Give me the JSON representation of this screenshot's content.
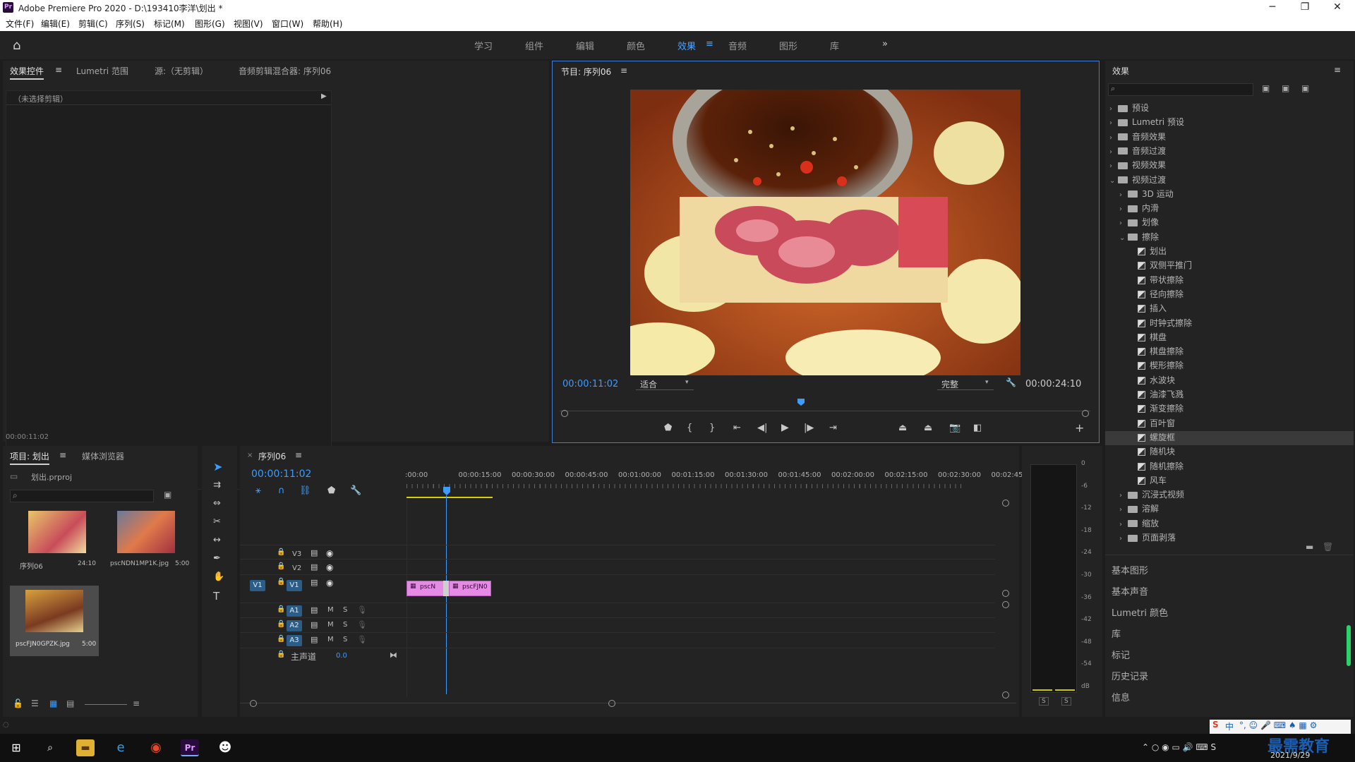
{
  "window": {
    "app_badge": "Pr",
    "title": "Adobe Premiere Pro 2020 - D:\\193410李洋\\划出 *",
    "minimize": "─",
    "maximize": "❐",
    "close": "✕"
  },
  "menu": [
    "文件(F)",
    "编辑(E)",
    "剪辑(C)",
    "序列(S)",
    "标记(M)",
    "图形(G)",
    "视图(V)",
    "窗口(W)",
    "帮助(H)"
  ],
  "workspaces": [
    "学习",
    "组件",
    "编辑",
    "颜色",
    "效果",
    "音频",
    "图形",
    "库"
  ],
  "workspace_active": "效果",
  "workspace_more": "»",
  "source_panel": {
    "tabs": [
      "效果控件",
      "Lumetri 范围",
      "源:（无剪辑）",
      "音频剪辑混合器: 序列06"
    ],
    "no_clip": "（未选择剪辑）",
    "timecode": "00:00:11:02"
  },
  "program": {
    "title": "节目: 序列06",
    "timecode": "00:00:11:02",
    "fit": "适合",
    "quality": "完整",
    "duration": "00:00:24:10"
  },
  "effects_panel": {
    "title": "效果",
    "tree": [
      {
        "label": "预设",
        "level": 0,
        "type": "folder",
        "open": false
      },
      {
        "label": "Lumetri 预设",
        "level": 0,
        "type": "folder",
        "open": false
      },
      {
        "label": "音频效果",
        "level": 0,
        "type": "folder",
        "open": false
      },
      {
        "label": "音频过渡",
        "level": 0,
        "type": "folder",
        "open": false
      },
      {
        "label": "视频效果",
        "level": 0,
        "type": "folder",
        "open": false
      },
      {
        "label": "视频过渡",
        "level": 0,
        "type": "folder",
        "open": true
      },
      {
        "label": "3D 运动",
        "level": 1,
        "type": "folder",
        "open": false
      },
      {
        "label": "内滑",
        "level": 1,
        "type": "folder",
        "open": false
      },
      {
        "label": "划像",
        "level": 1,
        "type": "folder",
        "open": false
      },
      {
        "label": "擦除",
        "level": 1,
        "type": "folder",
        "open": true
      },
      {
        "label": "划出",
        "level": 2,
        "type": "fx"
      },
      {
        "label": "双侧平推门",
        "level": 2,
        "type": "fx"
      },
      {
        "label": "带状擦除",
        "level": 2,
        "type": "fx"
      },
      {
        "label": "径向擦除",
        "level": 2,
        "type": "fx"
      },
      {
        "label": "插入",
        "level": 2,
        "type": "fx"
      },
      {
        "label": "时钟式擦除",
        "level": 2,
        "type": "fx"
      },
      {
        "label": "棋盘",
        "level": 2,
        "type": "fx"
      },
      {
        "label": "棋盘擦除",
        "level": 2,
        "type": "fx"
      },
      {
        "label": "楔形擦除",
        "level": 2,
        "type": "fx"
      },
      {
        "label": "水波块",
        "level": 2,
        "type": "fx"
      },
      {
        "label": "油漆飞溅",
        "level": 2,
        "type": "fx"
      },
      {
        "label": "渐变擦除",
        "level": 2,
        "type": "fx"
      },
      {
        "label": "百叶窗",
        "level": 2,
        "type": "fx"
      },
      {
        "label": "螺旋框",
        "level": 2,
        "type": "fx",
        "selected": true
      },
      {
        "label": "随机块",
        "level": 2,
        "type": "fx"
      },
      {
        "label": "随机擦除",
        "level": 2,
        "type": "fx"
      },
      {
        "label": "风车",
        "level": 2,
        "type": "fx"
      },
      {
        "label": "沉浸式视频",
        "level": 1,
        "type": "folder",
        "open": false
      },
      {
        "label": "溶解",
        "level": 1,
        "type": "folder",
        "open": false
      },
      {
        "label": "缩放",
        "level": 1,
        "type": "folder",
        "open": false
      },
      {
        "label": "页面剥落",
        "level": 1,
        "type": "folder",
        "open": false
      }
    ],
    "collapsed_panels": [
      "基本图形",
      "基本声音",
      "Lumetri 颜色",
      "库",
      "标记",
      "历史记录",
      "信息"
    ]
  },
  "project": {
    "tabs": [
      "项目: 划出",
      "媒体浏览器"
    ],
    "file": "划出.prproj",
    "items": [
      {
        "name": "序列06",
        "dur": "24:10"
      },
      {
        "name": "pscNDN1MP1K.jpg",
        "dur": "5:00"
      },
      {
        "name": "pscFJN0GPZK.jpg",
        "dur": "5:00"
      }
    ]
  },
  "timeline": {
    "tab": "序列06",
    "timecode": "00:00:11:02",
    "ruler": [
      ":00:00",
      "00:00:15:00",
      "00:00:30:00",
      "00:00:45:00",
      "00:01:00:00",
      "00:01:15:00",
      "00:01:30:00",
      "00:01:45:00",
      "00:02:00:00",
      "00:02:15:00",
      "00:02:30:00",
      "00:02:45:"
    ],
    "video_tracks": [
      "V3",
      "V2",
      "V1"
    ],
    "audio_tracks": [
      "A1",
      "A2",
      "A3"
    ],
    "source_patch": "V1",
    "master": "主声道",
    "master_val": "0.0",
    "clip1": "pscN",
    "clip2": "pscFJN0",
    "m": "M",
    "s": "S"
  },
  "meter": {
    "scale": [
      "0",
      "-6",
      "-12",
      "-18",
      "-24",
      "-30",
      "-36",
      "-42",
      "-48",
      "-54",
      "dB"
    ],
    "s_left": "S",
    "s_right": "S"
  },
  "taskbar": {
    "tray_watermark": "最需教育",
    "date": "2021/9/29",
    "ime": "中"
  },
  "colors": {
    "accent": "#3d9cff",
    "clip": "#e58be6",
    "panel": "#232323",
    "bg": "#1d1d1d"
  }
}
